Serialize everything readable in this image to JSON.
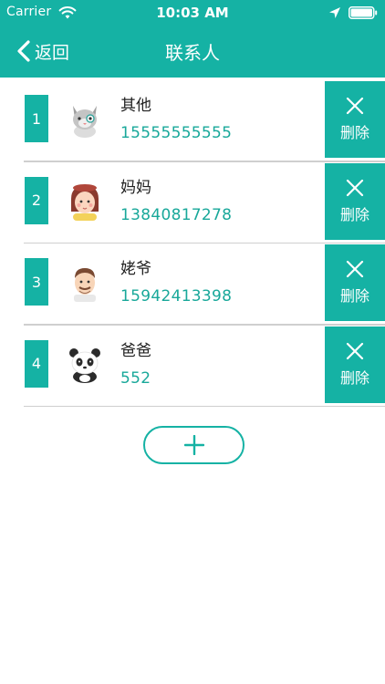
{
  "status_bar": {
    "carrier": "Carrier",
    "time": "10:03 AM"
  },
  "nav": {
    "back_label": "返回",
    "title": "联系人"
  },
  "contacts": [
    {
      "index": "1",
      "name": "其他",
      "phone": "15555555555",
      "avatar": "cat-avatar-icon"
    },
    {
      "index": "2",
      "name": "妈妈",
      "phone": "13840817278",
      "avatar": "mother-avatar-icon"
    },
    {
      "index": "3",
      "name": "姥爷",
      "phone": "15942413398",
      "avatar": "grandfather-avatar-icon"
    },
    {
      "index": "4",
      "name": "爸爸",
      "phone": "552",
      "avatar": "panda-avatar-icon"
    }
  ],
  "delete_label": "删除",
  "icons": {
    "back": "chevron-left-icon",
    "delete": "close-icon",
    "add": "plus-icon"
  },
  "colors": {
    "accent": "#15b2a4",
    "phone_text": "#19a89a",
    "divider": "#cfcfcf"
  }
}
